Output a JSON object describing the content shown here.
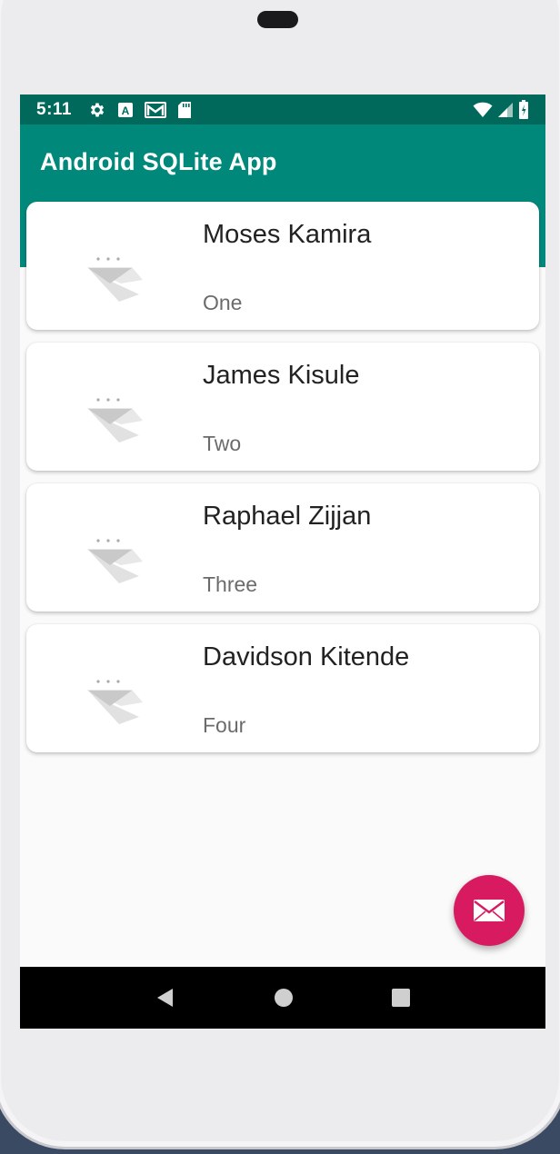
{
  "status_bar": {
    "time": "5:11",
    "icons_left": [
      "gear-icon",
      "a-icon",
      "gmail-icon",
      "sd-card-icon"
    ],
    "icons_right": [
      "wifi-icon",
      "signal-icon",
      "battery-icon"
    ]
  },
  "app_bar": {
    "title": "Android SQLite App"
  },
  "records": [
    {
      "name": "Moses Kamira",
      "subtitle": "One"
    },
    {
      "name": "James Kisule",
      "subtitle": "Two"
    },
    {
      "name": "Raphael Zijjan",
      "subtitle": "Three"
    },
    {
      "name": "Davidson Kitende",
      "subtitle": "Four"
    }
  ],
  "fab": {
    "icon": "email-icon",
    "color": "#d81b60"
  },
  "nav_bar": {
    "buttons": [
      "back-icon",
      "home-icon",
      "recents-icon"
    ]
  },
  "colors": {
    "primary": "#00897b",
    "primary_dark": "#00695c",
    "accent": "#d81b60"
  }
}
